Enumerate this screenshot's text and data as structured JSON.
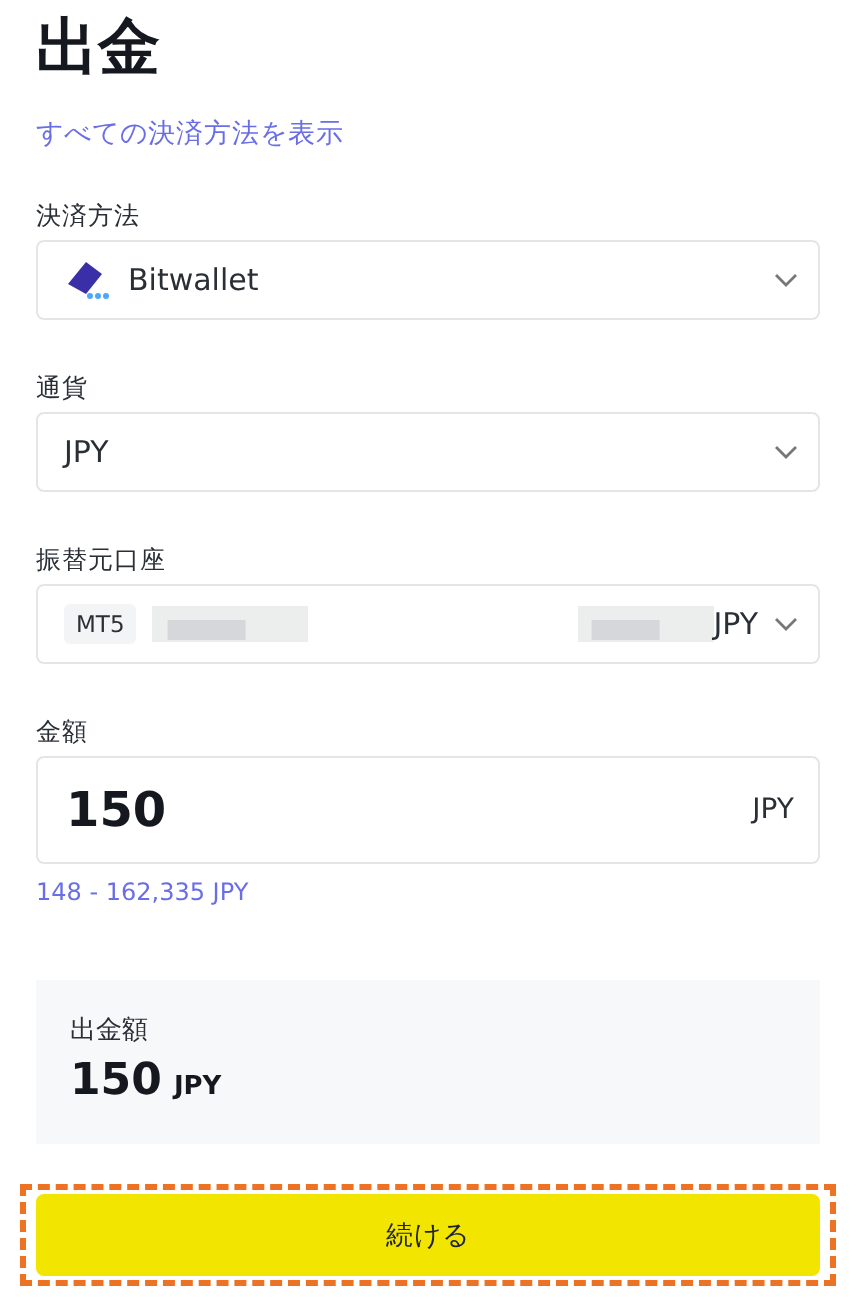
{
  "title": "出金",
  "all_methods_link": "すべての決済方法を表示",
  "fields": [
    {
      "kind": "select",
      "label": "決済方法",
      "value": "Bitwallet",
      "logo": true
    },
    {
      "kind": "select",
      "label": "通貨",
      "value": "JPY"
    },
    {
      "kind": "account",
      "label": "振替元口座",
      "badge": "MT5",
      "value": "JPY"
    },
    {
      "kind": "amount",
      "label": "金額",
      "value": "150",
      "suffix": "JPY",
      "hint": "148 - 162,335 JPY"
    }
  ],
  "summary": {
    "label": "出金額",
    "amount": "150",
    "currency": "JPY"
  },
  "continue_button": {
    "label": "続ける",
    "highlighted": true
  }
}
